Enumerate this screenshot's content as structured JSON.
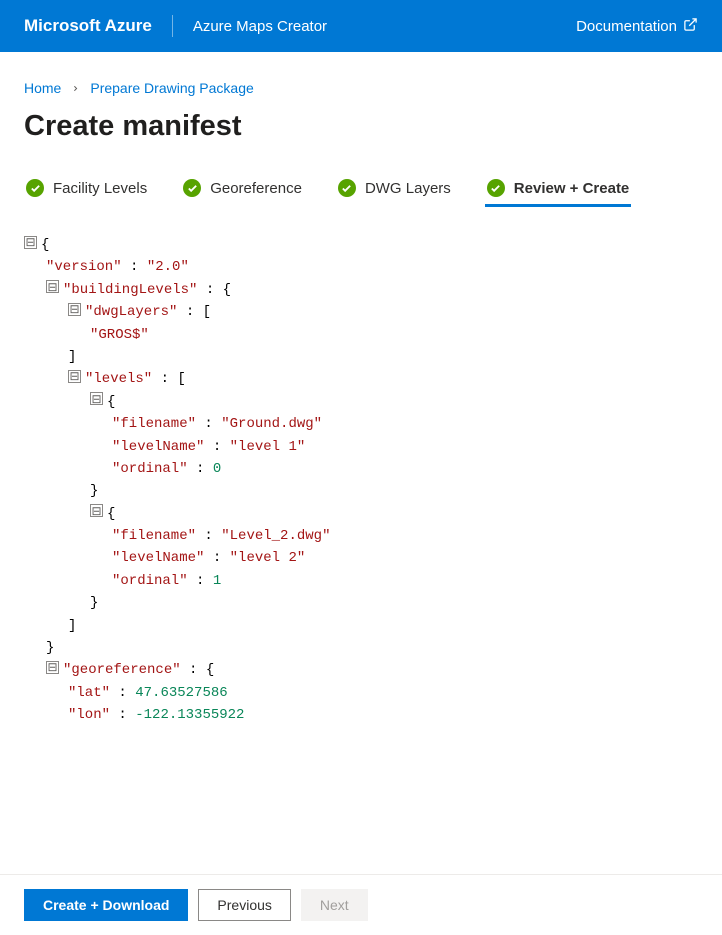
{
  "topbar": {
    "brand": "Microsoft Azure",
    "app_title": "Azure Maps Creator",
    "doc_link": "Documentation"
  },
  "breadcrumb": {
    "home": "Home",
    "current": "Prepare Drawing Package"
  },
  "page_title": "Create manifest",
  "tabs": [
    {
      "label": "Facility Levels",
      "active": false
    },
    {
      "label": "Georeference",
      "active": false
    },
    {
      "label": "DWG Layers",
      "active": false
    },
    {
      "label": "Review + Create",
      "active": true
    }
  ],
  "manifest": {
    "version": "2.0",
    "buildingLevels": {
      "dwgLayers": [
        "GROS$"
      ],
      "levels": [
        {
          "filename": "Ground.dwg",
          "levelName": "level 1",
          "ordinal": 0
        },
        {
          "filename": "Level_2.dwg",
          "levelName": "level 2",
          "ordinal": 1
        }
      ]
    },
    "georeference": {
      "lat": 47.63527586,
      "lon": -122.13355922
    }
  },
  "footer": {
    "primary": "Create + Download",
    "previous": "Previous",
    "next": "Next"
  }
}
